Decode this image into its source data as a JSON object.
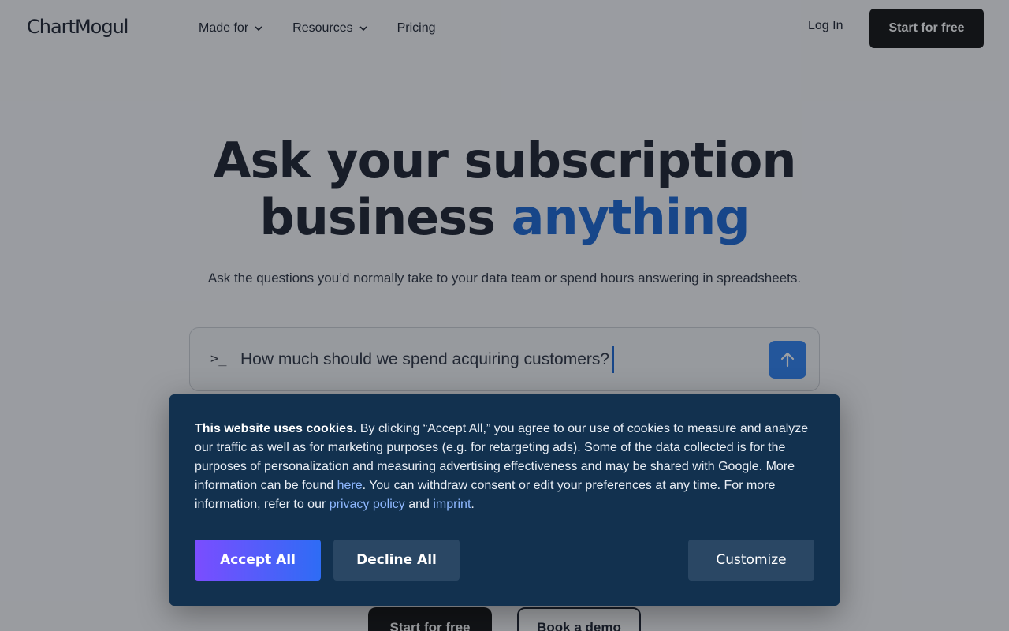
{
  "nav": {
    "logo": "ChartMogul",
    "links": [
      {
        "label": "Made for",
        "has_dropdown": true
      },
      {
        "label": "Resources",
        "has_dropdown": true
      },
      {
        "label": "Pricing",
        "has_dropdown": false
      }
    ],
    "login": "Log In",
    "start": "Start for free"
  },
  "hero": {
    "title_line1": "Ask your subscription",
    "title_line2_plain": "business ",
    "title_line2_accent": "anything",
    "subtitle": "Ask the questions you’d normally take to your data team or spend hours answering in spreadsheets.",
    "prompt_glyph": ">_",
    "prompt_value": "How much should we spend acquiring customers?",
    "cta_primary": "Start for free",
    "cta_secondary": "Book a demo"
  },
  "cookie": {
    "bold": "This website uses cookies.",
    "text1": " By clicking “Accept All,” you agree to our use of cookies to measure and analyze our traffic as well as for marketing purposes (e.g. for retargeting ads). Some of the data collected is for the purposes of personalization and measuring advertising effectiveness and may be shared with Google. More information can be found ",
    "link_here": "here",
    "text2": ". You can withdraw consent or edit your preferences at any time. For more information, refer to our ",
    "link_privacy": "privacy policy",
    "text3": " and ",
    "link_imprint": "imprint",
    "text4": ".",
    "accept": "Accept All",
    "decline": "Decline All",
    "customize": "Customize"
  },
  "colors": {
    "accent": "#0a5bd0",
    "cookie_bg": "#12314f",
    "submit": "#1f78f0"
  },
  "icons": {
    "dropdown": "chevron-down-icon",
    "submit": "arrow-up-icon"
  }
}
